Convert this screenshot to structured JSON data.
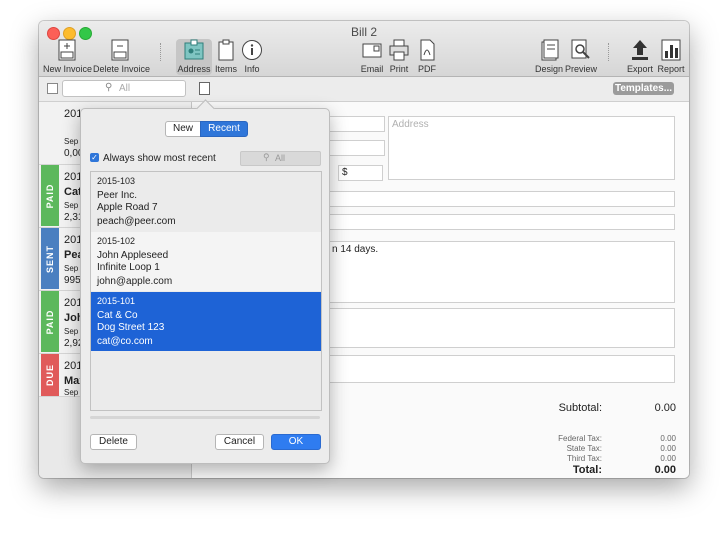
{
  "window": {
    "title": "Bill 2"
  },
  "toolbar": {
    "new_invoice": "New Invoice",
    "delete_invoice": "Delete Invoice",
    "address": "Address",
    "items": "Items",
    "info": "Info",
    "email": "Email",
    "print": "Print",
    "pdf": "PDF",
    "design": "Design",
    "preview": "Preview",
    "export": "Export",
    "report": "Report"
  },
  "subbar": {
    "search_placeholder": "All",
    "templates_button": "Templates..."
  },
  "invoice_list": [
    {
      "number": "201",
      "date": "Sep 1",
      "amount": "0,00",
      "status": "",
      "name": ""
    },
    {
      "number": "201",
      "name": "Cat",
      "date": "Sep 1",
      "amount": "2,31",
      "status": "PAID"
    },
    {
      "number": "201",
      "name": "Pea",
      "date": "Sep 1",
      "amount": "995",
      "status": "SENT"
    },
    {
      "number": "201",
      "name": "Joh",
      "date": "Sep 1",
      "amount": "2,92",
      "status": "PAID"
    },
    {
      "number": "201",
      "name": "Max",
      "date": "Sep 1",
      "amount": "",
      "status": "DUE"
    }
  ],
  "status_colors": {
    "PAID": "#5cb85c",
    "SENT": "#4a7fc0",
    "DUE": "#e05a5a"
  },
  "editor": {
    "address_placeholder": "Address",
    "currency": "$",
    "notes_text": "n 14 days.",
    "subtotal_label": "Subtotal:",
    "subtotal_value": "0.00",
    "federal_tax_label": "Federal Tax:",
    "federal_tax_value": "0.00",
    "state_tax_label": "State Tax:",
    "state_tax_value": "0.00",
    "third_tax_label": "Third Tax:",
    "third_tax_value": "0.00",
    "total_label": "Total:",
    "total_value": "0.00"
  },
  "popover": {
    "tab_new": "New",
    "tab_recent": "Recent",
    "always_show_label": "Always show most recent",
    "search_placeholder": "All",
    "delete_button": "Delete",
    "cancel_button": "Cancel",
    "ok_button": "OK",
    "records": [
      {
        "id": "2015-103",
        "name": "Peer Inc.",
        "street": "Apple Road 7",
        "email": "peach@peer.com",
        "selected": false
      },
      {
        "id": "2015-102",
        "name": "John Appleseed",
        "street": "Infinite Loop 1",
        "email": "john@apple.com",
        "selected": false
      },
      {
        "id": "2015-101",
        "name": "Cat & Co",
        "street": "Dog Street 123",
        "email": "cat@co.com",
        "selected": true
      }
    ]
  }
}
